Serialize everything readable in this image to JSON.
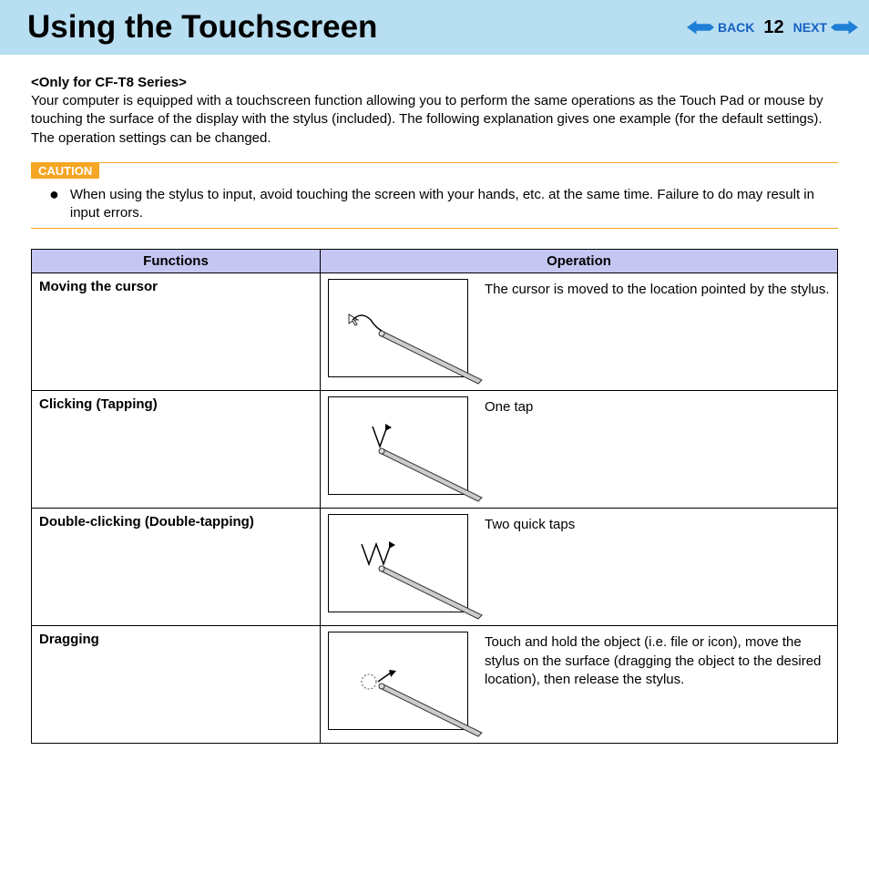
{
  "header": {
    "title": "Using the Touchscreen",
    "back": "BACK",
    "page": "12",
    "next": "NEXT"
  },
  "subtitle": "<Only for CF-T8 Series>",
  "intro": "Your computer is equipped with a touchscreen function allowing you to perform the same operations as the Touch Pad or mouse by touching the surface of the display with the stylus (included). The following explanation gives one example (for the default settings).\nThe operation settings can be changed.",
  "caution": {
    "label": "CAUTION",
    "text": "When using the stylus to input, avoid touching the screen with your hands, etc. at the same time. Failure to do may result in input errors."
  },
  "table": {
    "headers": {
      "func": "Functions",
      "op": "Operation"
    },
    "rows": [
      {
        "func": "Moving the cursor",
        "op": "The cursor is moved to the location pointed by the stylus.",
        "diagram": "move"
      },
      {
        "func": "Clicking (Tapping)",
        "op": "One tap",
        "diagram": "tap"
      },
      {
        "func": "Double-clicking (Double-tapping)",
        "op": "Two quick taps",
        "diagram": "doubletap"
      },
      {
        "func": "Dragging",
        "op": "Touch and hold the object (i.e. file or icon), move the stylus on the surface (dragging the object to the desired location), then release the stylus.",
        "diagram": "drag"
      }
    ]
  }
}
